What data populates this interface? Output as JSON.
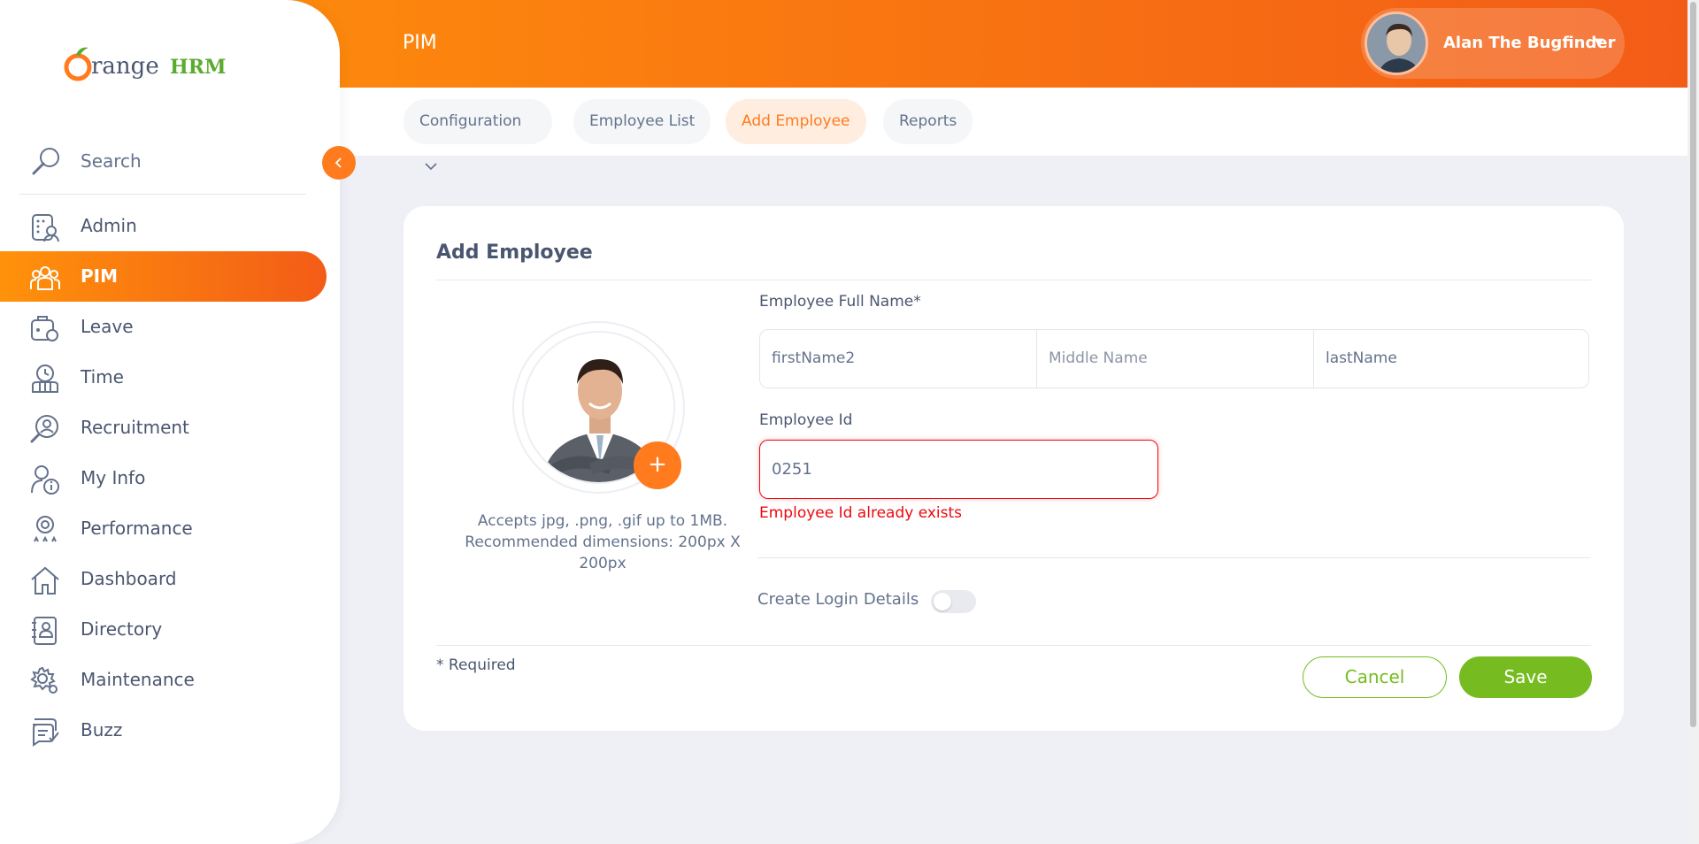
{
  "header": {
    "page_title": "PIM",
    "user_name": "Alan The Bugfinder",
    "caret_icon": "caret-down-icon"
  },
  "brand": {
    "logo_part1": "range",
    "logo_part2": "HRM",
    "accent": "#ff7b1d",
    "green": "#76bc21",
    "error": "#eb0910"
  },
  "sidebar": {
    "search_label": "Search",
    "items": [
      {
        "label": "Admin",
        "icon": "admin-icon"
      },
      {
        "label": "PIM",
        "icon": "pim-icon",
        "active": true
      },
      {
        "label": "Leave",
        "icon": "leave-icon"
      },
      {
        "label": "Time",
        "icon": "time-icon"
      },
      {
        "label": "Recruitment",
        "icon": "recruitment-icon"
      },
      {
        "label": "My Info",
        "icon": "my-info-icon"
      },
      {
        "label": "Performance",
        "icon": "performance-icon"
      },
      {
        "label": "Dashboard",
        "icon": "dashboard-icon"
      },
      {
        "label": "Directory",
        "icon": "directory-icon"
      },
      {
        "label": "Maintenance",
        "icon": "maintenance-icon"
      },
      {
        "label": "Buzz",
        "icon": "buzz-icon"
      }
    ]
  },
  "subnav": {
    "tabs": [
      {
        "label": "Configuration"
      },
      {
        "label": "Employee List"
      },
      {
        "label": "Add Employee",
        "active": true
      },
      {
        "label": "Reports"
      }
    ]
  },
  "form": {
    "title": "Add Employee",
    "photo_hint": "Accepts jpg, .png, .gif up to 1MB. Recommended dimensions: 200px X 200px",
    "full_name_label": "Employee Full Name*",
    "first_name_value": "firstName2",
    "middle_name_placeholder": "Middle Name",
    "last_name_value": "lastName",
    "employee_id_label": "Employee Id",
    "employee_id_value": "0251",
    "employee_id_error": "Employee Id already exists",
    "create_login_label": "Create Login Details",
    "create_login_enabled": false,
    "required_note": "* Required",
    "cancel_label": "Cancel",
    "save_label": "Save"
  }
}
